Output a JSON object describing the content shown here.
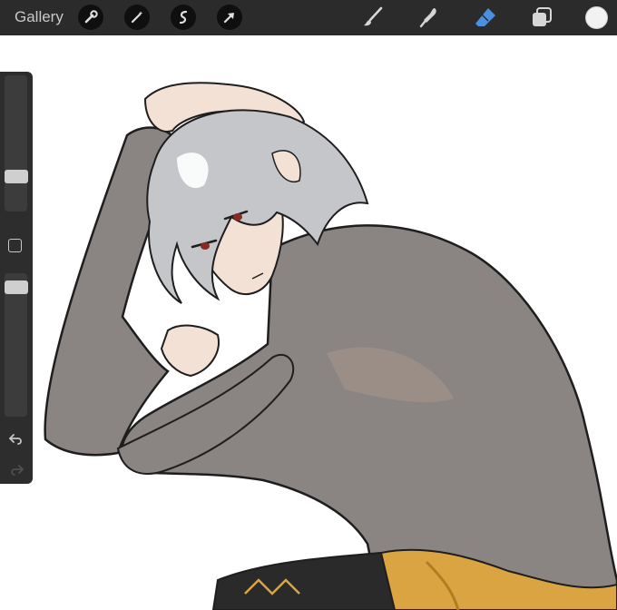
{
  "toolbar": {
    "gallery_label": "Gallery",
    "left_tools": [
      "wrench-icon",
      "magic-wand-icon",
      "selection-icon",
      "transform-arrow-icon"
    ],
    "right_tools": [
      "brush-icon",
      "smudge-icon",
      "eraser-icon",
      "layers-icon",
      "color-picker"
    ],
    "active_tool": "eraser",
    "active_color": "#4a90e2",
    "current_color": "#f2f2f2"
  },
  "sidebar": {
    "brush_size_level": 0.72,
    "opacity_level": 0.05,
    "controls": [
      "brush-size-slider",
      "modify-button",
      "opacity-slider",
      "undo-icon",
      "redo-icon"
    ]
  },
  "canvas": {
    "artwork": "anime-figure-drawing",
    "colors": {
      "shirt": "#8a8582",
      "skin": "#f3e1d6",
      "hair": "#c4c6ca",
      "pants": "#2a2a2a",
      "belt": "#d9a441",
      "outline": "#1e1e1e"
    }
  }
}
